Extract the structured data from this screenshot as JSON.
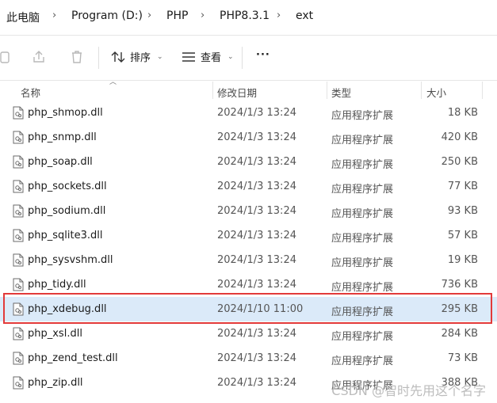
{
  "breadcrumb": [
    "此电脑",
    "Program (D:)",
    "PHP",
    "PHP8.3.1",
    "ext"
  ],
  "toolbar": {
    "sort_label": "排序",
    "view_label": "查看",
    "more_label": "···"
  },
  "columns": {
    "name": "名称",
    "date": "修改日期",
    "type": "类型",
    "size": "大小"
  },
  "files": [
    {
      "name": "php_shmop.dll",
      "date": "2024/1/3 13:24",
      "type": "应用程序扩展",
      "size": "18 KB"
    },
    {
      "name": "php_snmp.dll",
      "date": "2024/1/3 13:24",
      "type": "应用程序扩展",
      "size": "420 KB"
    },
    {
      "name": "php_soap.dll",
      "date": "2024/1/3 13:24",
      "type": "应用程序扩展",
      "size": "250 KB"
    },
    {
      "name": "php_sockets.dll",
      "date": "2024/1/3 13:24",
      "type": "应用程序扩展",
      "size": "77 KB"
    },
    {
      "name": "php_sodium.dll",
      "date": "2024/1/3 13:24",
      "type": "应用程序扩展",
      "size": "93 KB"
    },
    {
      "name": "php_sqlite3.dll",
      "date": "2024/1/3 13:24",
      "type": "应用程序扩展",
      "size": "57 KB"
    },
    {
      "name": "php_sysvshm.dll",
      "date": "2024/1/3 13:24",
      "type": "应用程序扩展",
      "size": "19 KB"
    },
    {
      "name": "php_tidy.dll",
      "date": "2024/1/3 13:24",
      "type": "应用程序扩展",
      "size": "736 KB"
    },
    {
      "name": "php_xdebug.dll",
      "date": "2024/1/10 11:00",
      "type": "应用程序扩展",
      "size": "295 KB"
    },
    {
      "name": "php_xsl.dll",
      "date": "2024/1/3 13:24",
      "type": "应用程序扩展",
      "size": "284 KB"
    },
    {
      "name": "php_zend_test.dll",
      "date": "2024/1/3 13:24",
      "type": "应用程序扩展",
      "size": "73 KB"
    },
    {
      "name": "php_zip.dll",
      "date": "2024/1/3 13:24",
      "type": "应用程序扩展",
      "size": "388 KB"
    }
  ],
  "selected_file": "php_xdebug.dll",
  "highlight_color": "#e23a3a",
  "selection_color": "#dbeaf9",
  "watermark": "CSDN @智时先用这个名字"
}
